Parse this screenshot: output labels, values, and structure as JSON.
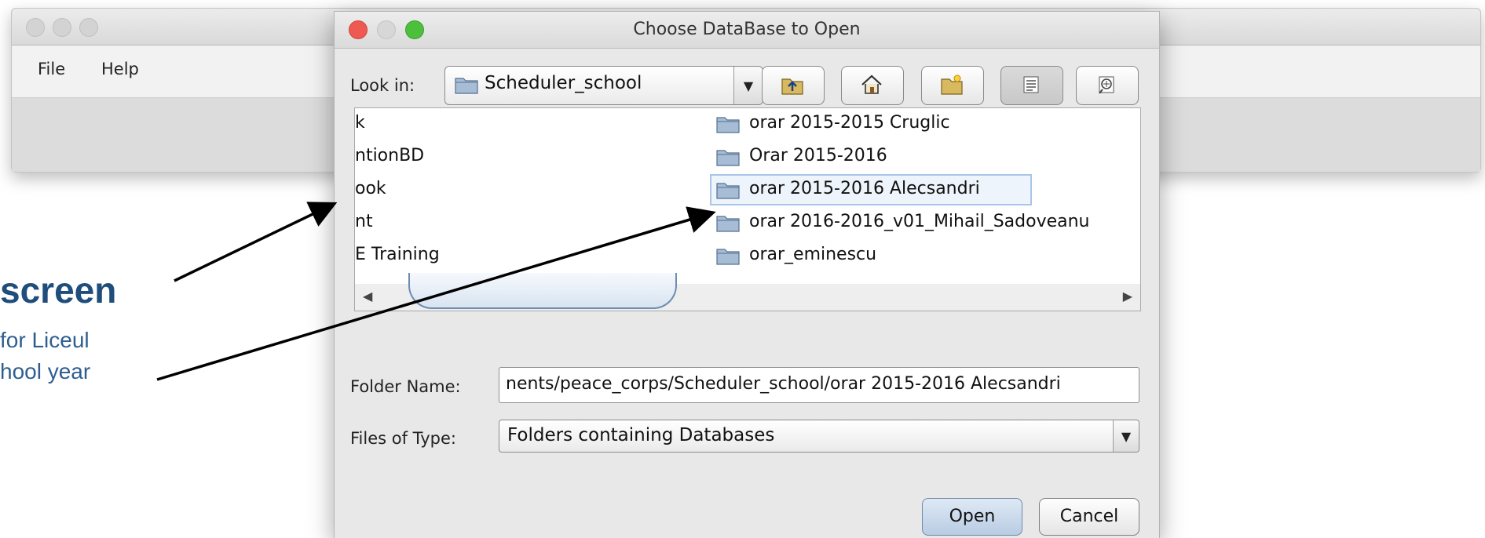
{
  "background_window": {
    "menu": [
      "File",
      "Help"
    ]
  },
  "annotation": {
    "title": "screen",
    "line1": "for Liceul",
    "line2": "hool year"
  },
  "dialog": {
    "title": "Choose DataBase to Open",
    "look_in_label": "Look in:",
    "look_in_value": "Scheduler_school",
    "toolbar": [
      {
        "name": "up-one-level-icon"
      },
      {
        "name": "home-icon"
      },
      {
        "name": "new-folder-icon"
      },
      {
        "name": "list-view-icon"
      },
      {
        "name": "details-view-icon"
      }
    ],
    "left_column_items": [
      "k",
      "ntionBD",
      "ook",
      "nt",
      "E Training"
    ],
    "right_column_items": [
      "orar 2015-2015 Cruglic",
      "Orar 2015-2016",
      "orar 2015-2016 Alecsandri",
      "orar 2016-2016_v01_Mihail_Sadoveanu",
      "orar_eminescu"
    ],
    "selected_item": "orar 2015-2016 Alecsandri",
    "folder_name_label": "Folder Name:",
    "folder_name_value": "nents/peace_corps/Scheduler_school/orar 2015-2016 Alecsandri",
    "files_of_type_label": "Files of Type:",
    "files_of_type_value": "Folders containing Databases",
    "open_label": "Open",
    "cancel_label": "Cancel"
  },
  "colors": {
    "annotation_blue": "#1f4e7d",
    "selection_outline": "#a9c6e8",
    "close_button": "#ee5a52",
    "zoom_button": "#4cc03c"
  }
}
